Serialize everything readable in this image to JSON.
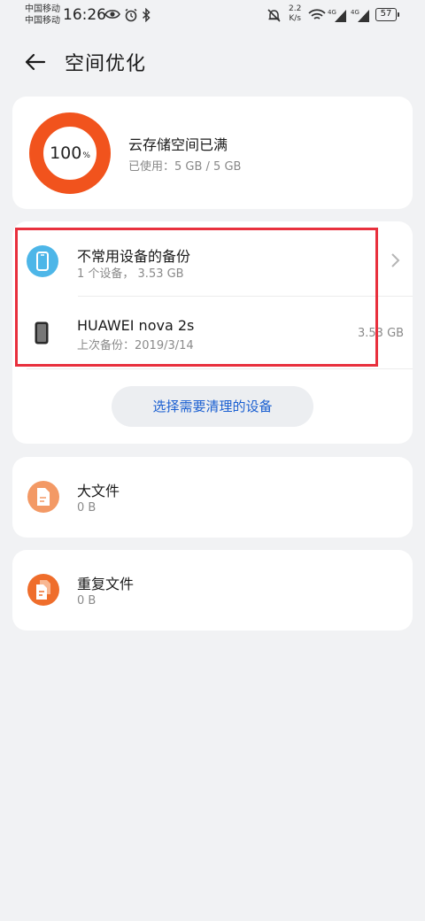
{
  "status_bar": {
    "carrier_1": "中国移动",
    "carrier_2": "中国移动",
    "time": "16:26",
    "net_speed_value": "2.2",
    "net_speed_unit": "K/s",
    "signal_1_label": "4G",
    "signal_2_label": "4G",
    "battery": "57",
    "icons": [
      "eye-icon",
      "alarm-icon",
      "bluetooth-icon",
      "mute-icon",
      "wifi-icon",
      "signal-icon",
      "signal-icon",
      "battery-icon"
    ]
  },
  "header": {
    "back_icon": "arrow-left-icon",
    "title": "空间优化"
  },
  "storage": {
    "percent": "100",
    "percent_unit": "%",
    "percent_value": 1.0,
    "title": "云存储空间已满",
    "used": "已使用：5 GB / 5 GB",
    "ring_color": "#f1531d"
  },
  "backup": {
    "category": {
      "icon": "phone-icon",
      "title": "不常用设备的备份",
      "subtitle": "1 个设备，  3.53 GB"
    },
    "device": {
      "icon": "phone-device-icon",
      "name": "HUAWEI nova 2s",
      "last_backup": "上次备份：2019/3/14",
      "size": "3.53 GB"
    },
    "select_button": "选择需要清理的设备"
  },
  "files": [
    {
      "icon": "document-icon",
      "title": "大文件",
      "size": "0 B"
    },
    {
      "icon": "duplicate-document-icon",
      "title": "重复文件",
      "size": "0 B"
    }
  ],
  "colors": {
    "accent_blue": "#1a5fd1",
    "ring_orange": "#f1531d",
    "highlight_red": "#e8303d",
    "bigfile_orange": "#f39965",
    "dupfile_orange": "#ef6d2b",
    "phone_blue": "#4db6e8"
  }
}
